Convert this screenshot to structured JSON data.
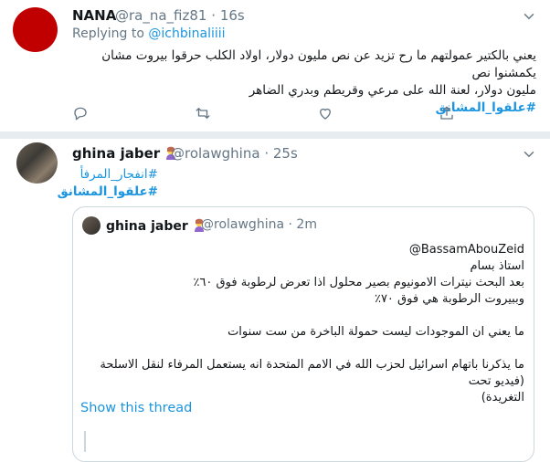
{
  "tweet1": {
    "name": "NANA",
    "handle": "@ra_na_fiz81",
    "dot": "·",
    "time": "16s",
    "replying_prefix": "Replying to",
    "replying_to": "@ichbinaliiii",
    "text_line1": "يعني بالكتير عمولتهم ما رح تزيد عن نص مليون دولار، اولاد الكلب حرقوا بيروت مشان يكمشنوا نص",
    "text_line2": "مليون دولار، لعنة الله على مرعي وقريطم وبدري الضاهر",
    "hashtag": "#علقوا_المشانق"
  },
  "tweet2": {
    "name": "ghina jaber",
    "handle": "@rolawghina",
    "dot": "·",
    "time": "25s",
    "hashtag1": "#انفجار_المرفأ",
    "hashtag2": "#علقوا_المشانق"
  },
  "quote": {
    "name": "ghina jaber",
    "handle": "@rolawghina",
    "dot": "·",
    "time": "2m",
    "mention": "@BassamAbouZeid",
    "line1": "استاذ بسام",
    "line2": "بعد البحث نيترات الامونيوم بصير محلول اذا تعرض لرطوبة فوق ٦٠٪",
    "line3": "وببيروت الرطوبة هي فوق ٧٠٪",
    "line4": "ما يعني ان الموجودات ليست حمولة الباخرة من ست سنوات",
    "line5": "ما يذكرنا باتهام اسرائيل لحزب الله في الامم المتحدة انه يستعمل المرفاء لنقل الاسلحة (فيديو تحت",
    "line6": "التغريدة)"
  },
  "show_thread": "Show this thread",
  "colors": {
    "link": "#1b95e0",
    "secondary": "#657786",
    "avatar_red": "#c00000"
  }
}
